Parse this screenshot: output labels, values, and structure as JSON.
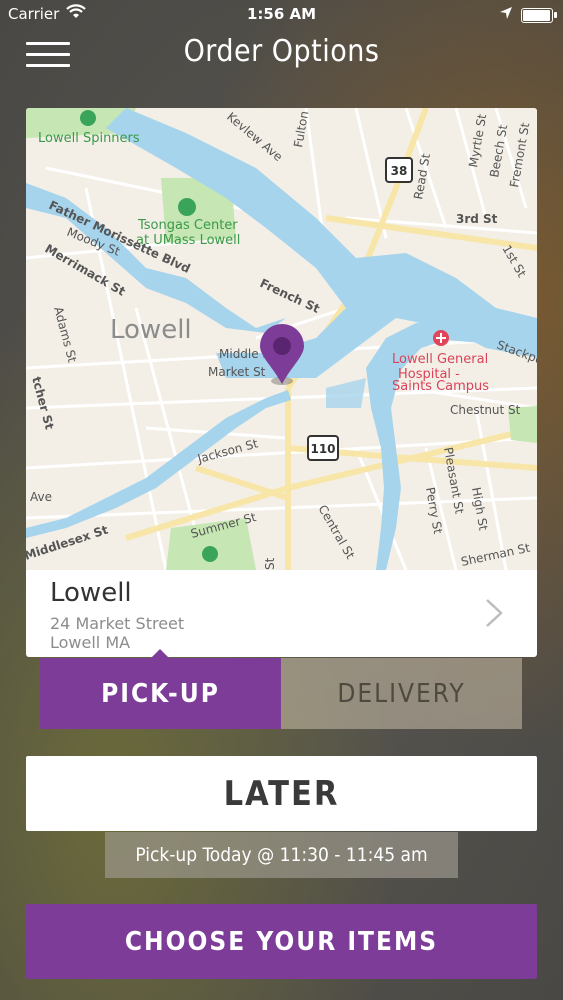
{
  "status_bar": {
    "carrier": "Carrier",
    "time": "1:56 AM"
  },
  "header": {
    "title": "Order Options",
    "menu_icon": "hamburger-menu-icon"
  },
  "map": {
    "labels": {
      "lowell_spinners": "Lowell Spinners",
      "tsongas_1": "Tsongas Center",
      "tsongas_2": "at UMass Lowell",
      "father_morissette": "Father Morissette Blvd",
      "moody": "Moody St",
      "merrimack": "Merrimack St",
      "adams": "Adams St",
      "lowell": "Lowell",
      "french": "French St",
      "middle": "Middle St",
      "market": "Market St",
      "jackson": "Jackson St",
      "summer": "Summer St",
      "middlesex": "Middlesex St",
      "ave": "Ave",
      "thatcher": "tcher St",
      "central": "Central St",
      "hospital_1": "Lowell General",
      "hospital_2": "Hospital -",
      "hospital_3": "Saints Campus",
      "chestnut": "Chestnut St",
      "pleasant": "Pleasant St",
      "high": "High St",
      "perry": "Perry St",
      "sherman": "Sherman St",
      "stackpole": "Stackpo",
      "read": "Read St",
      "myrtle": "Myrtle St",
      "beech": "Beech St",
      "fremont": "Fremont St",
      "third": "3rd St",
      "first": "1st St",
      "fulton": "Fulton St",
      "kirk": "Kevlew Ave",
      "st_bottom": "St",
      "route_38": "38",
      "route_110": "110"
    },
    "colors": {
      "land": "#f3efe6",
      "water": "#a6d4ec",
      "park": "#c6e6b4",
      "road": "#ffffff",
      "major_road": "#f7e6a8",
      "pin": "#7d3c98"
    }
  },
  "location": {
    "name": "Lowell",
    "address_line1": "24 Market Street",
    "address_line2": "Lowell MA"
  },
  "order_type": {
    "pickup_label": "PICK-UP",
    "delivery_label": "DELIVERY",
    "selected": "pickup"
  },
  "timing": {
    "later_label": "LATER",
    "pickup_time": "Pick-up Today @ 11:30 - 11:45 am"
  },
  "cta": {
    "label": "CHOOSE YOUR ITEMS"
  },
  "colors": {
    "accent": "#7d3c98",
    "white": "#ffffff"
  }
}
